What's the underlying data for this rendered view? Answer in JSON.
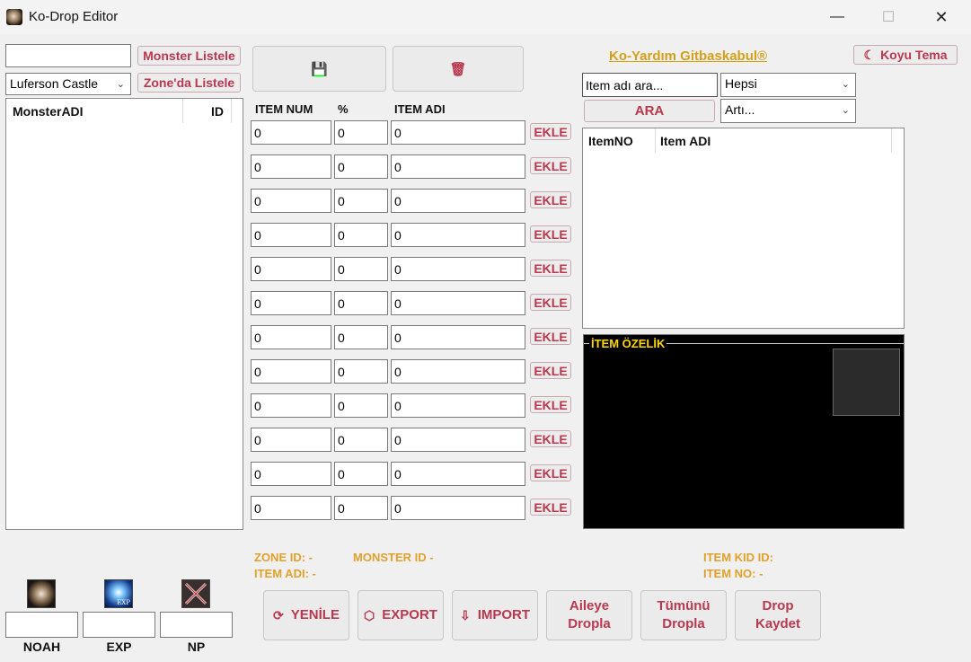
{
  "window": {
    "title": "Ko-Drop Editor",
    "minimize_glyph": "—",
    "maximize_glyph": "☐",
    "close_glyph": "✕"
  },
  "left": {
    "monster_search_value": "",
    "monster_list_btn": "Monster Listele",
    "zone_selected": "Luferson Castle",
    "zone_list_btn": "Zone'da Listele",
    "grid_headers": [
      "MonsterADI",
      "ID"
    ]
  },
  "toolbar_icons": {
    "save_icon": "💾",
    "delete_icon": "🗑"
  },
  "items": {
    "headers": {
      "num": "ITEM NUM",
      "pct": "%",
      "name": "ITEM ADI"
    },
    "add_label": "EKLE",
    "rows": [
      {
        "num": "0",
        "pct": "0",
        "name": "0"
      },
      {
        "num": "0",
        "pct": "0",
        "name": "0"
      },
      {
        "num": "0",
        "pct": "0",
        "name": "0"
      },
      {
        "num": "0",
        "pct": "0",
        "name": "0"
      },
      {
        "num": "0",
        "pct": "0",
        "name": "0"
      },
      {
        "num": "0",
        "pct": "0",
        "name": "0"
      },
      {
        "num": "0",
        "pct": "0",
        "name": "0"
      },
      {
        "num": "0",
        "pct": "0",
        "name": "0"
      },
      {
        "num": "0",
        "pct": "0",
        "name": "0"
      },
      {
        "num": "0",
        "pct": "0",
        "name": "0"
      },
      {
        "num": "0",
        "pct": "0",
        "name": "0"
      },
      {
        "num": "0",
        "pct": "0",
        "name": "0"
      }
    ]
  },
  "right": {
    "link_text": "Ko-Yardım Gitbaskabul®",
    "theme_btn": "Koyu Tema",
    "item_search_placeholder": "Item adı ara...",
    "filter1": "Hepsi",
    "search_btn": "ARA",
    "filter2": "Artı...",
    "grid_headers": [
      "ItemNO",
      "Item ADI"
    ],
    "ozelik_title": "İTEM ÖZELİK"
  },
  "info": {
    "zone_id": "ZONE ID: -",
    "monster_id": "MONSTER ID -",
    "item_adi": "ITEM ADI: -",
    "item_kid_id": "ITEM KID ID:",
    "item_no": "ITEM NO: -"
  },
  "buttons": {
    "yenile": "YENİLE",
    "export": "EXPORT",
    "import": "IMPORT",
    "aileye_dropla_1": "Aileye",
    "aileye_dropla_2": "Dropla",
    "tumunu_dropla_1": "Tümünü",
    "tumunu_dropla_2": "Dropla",
    "drop_kaydet_1": "Drop",
    "drop_kaydet_2": "Kaydet"
  },
  "stats": {
    "noah_label": "NOAH",
    "exp_label": "EXP",
    "np_label": "NP",
    "noah_value": "",
    "exp_value": "",
    "np_value": "",
    "exp_icon_text": "EXP"
  },
  "colors": {
    "accent": "#b8384f",
    "link": "#d4a017",
    "info": "#e0a12a",
    "ozelik_title": "#ffd700"
  }
}
